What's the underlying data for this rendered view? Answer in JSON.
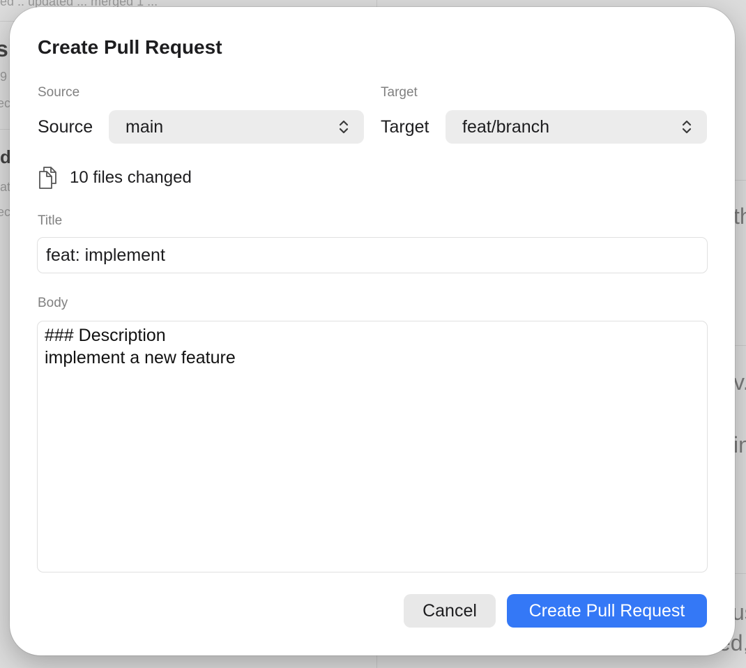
{
  "background": {
    "fragments": [
      {
        "text": "ed ..  updated ...  merged 1 ..."
      },
      {
        "text": "sn"
      },
      {
        "text": "9"
      },
      {
        "text": "ec"
      },
      {
        "text": "d"
      },
      {
        "text": "at"
      },
      {
        "text": "ec"
      },
      {
        "text": "th"
      },
      {
        "text": "v."
      },
      {
        "text": "in"
      },
      {
        "text": "us"
      },
      {
        "text": "ed,"
      }
    ]
  },
  "dialog": {
    "title": "Create Pull Request",
    "source": {
      "section_label": "Source",
      "inline_label": "Source",
      "selected": "main"
    },
    "target": {
      "section_label": "Target",
      "inline_label": "Target",
      "selected": "feat/branch"
    },
    "files_changed": {
      "icon": "documents-icon",
      "text": "10 files changed"
    },
    "title_field": {
      "label": "Title",
      "value": "feat: implement"
    },
    "body_field": {
      "label": "Body",
      "lines": [
        "### Description",
        "implement a new feature"
      ]
    },
    "buttons": {
      "cancel": "Cancel",
      "create": "Create Pull Request"
    },
    "colors": {
      "accent": "#3478f6",
      "popup_bg": "#ececec"
    }
  }
}
